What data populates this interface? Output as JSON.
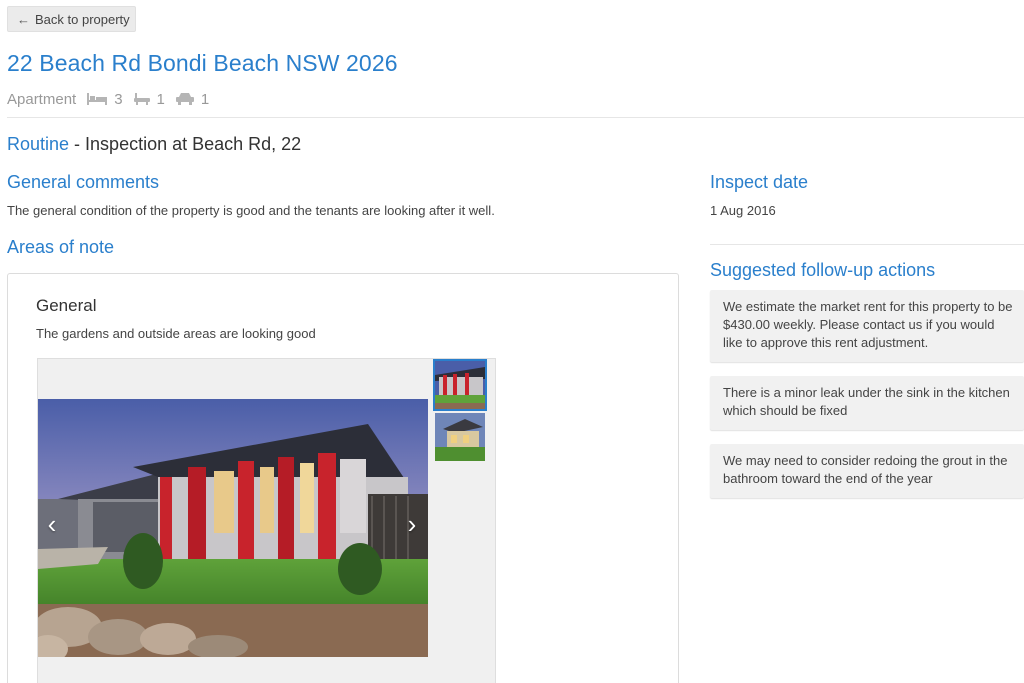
{
  "nav": {
    "back_label": "Back to property"
  },
  "property": {
    "address": "22 Beach Rd Bondi Beach NSW 2026",
    "type": "Apartment",
    "bedrooms": "3",
    "bathrooms": "1",
    "car_spaces": "1"
  },
  "inspection": {
    "kind": "Routine",
    "title": " - Inspection at Beach Rd, 22"
  },
  "general_comments": {
    "heading": "General comments",
    "text": "The general condition of the property is good and the tenants are looking after it well."
  },
  "inspect_date": {
    "heading": "Inspect date",
    "value": "1 Aug 2016"
  },
  "areas_of_note": {
    "heading": "Areas of note",
    "areas": [
      {
        "title": "General",
        "description": "The gardens and outside areas are looking good",
        "photo_count": 2,
        "active_photo": 0
      }
    ]
  },
  "follow_up": {
    "heading": "Suggested follow-up actions",
    "actions": [
      "We estimate the market rent for this property to be $430.00 weekly. Please contact us if you would like to approve this rent adjustment.",
      "There is a minor leak under the sink in the kitchen which should be fixed",
      "We may need to consider redoing the grout in the bathroom toward the end of the year"
    ]
  },
  "icons": {
    "back": "arrow-left-icon",
    "bed": "bed-icon",
    "bath": "bath-icon",
    "car": "car-icon",
    "prev": "chevron-left-icon",
    "next": "chevron-right-icon"
  },
  "colors": {
    "accent": "#2a7fcc",
    "muted": "#999999",
    "card_bg": "#f1f1f1"
  }
}
